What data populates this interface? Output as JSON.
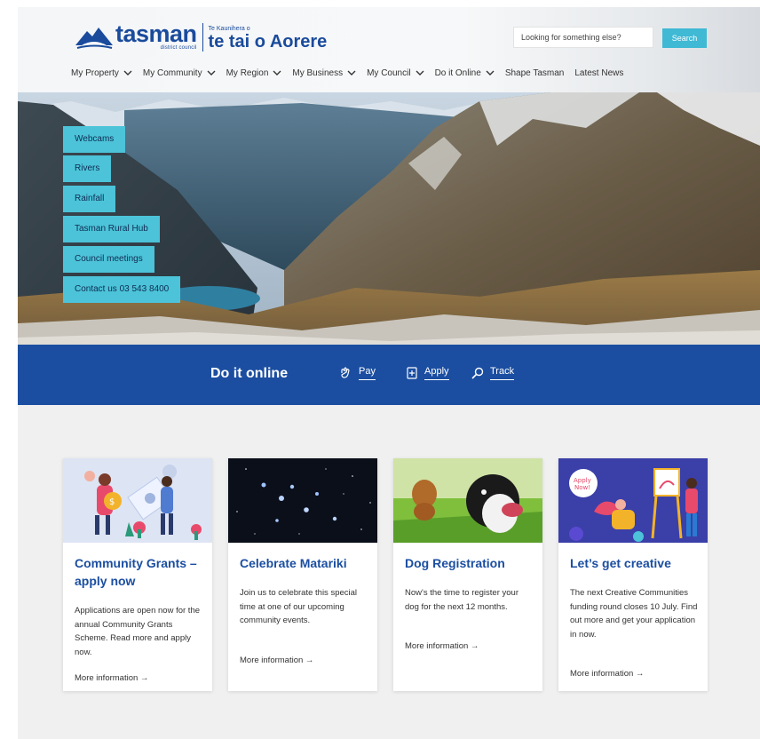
{
  "brand": {
    "name": "tasman",
    "sub": "district council",
    "maori_small": "Te Kaunihera o",
    "maori_big": "te tai o Aorere"
  },
  "search": {
    "placeholder": "Looking for something else?",
    "button_label": "Search"
  },
  "nav": {
    "items": [
      {
        "label": "My Property",
        "dropdown": true
      },
      {
        "label": "My Community",
        "dropdown": true
      },
      {
        "label": "My Region",
        "dropdown": true
      },
      {
        "label": "My Business",
        "dropdown": true
      },
      {
        "label": "My Council",
        "dropdown": true
      },
      {
        "label": "Do it Online",
        "dropdown": true
      },
      {
        "label": "Shape Tasman",
        "dropdown": false
      },
      {
        "label": "Latest News",
        "dropdown": false
      }
    ]
  },
  "quick_links": [
    "Webcams",
    "Rivers",
    "Rainfall",
    "Tasman Rural Hub",
    "Council meetings",
    "Contact us 03 543 8400"
  ],
  "do_it_online": {
    "title": "Do it online",
    "links": [
      {
        "label": "Pay",
        "icon": "pay-hand-icon"
      },
      {
        "label": "Apply",
        "icon": "apply-document-icon"
      },
      {
        "label": "Track",
        "icon": "track-magnifier-icon"
      }
    ]
  },
  "cards": [
    {
      "title": "Community Grants – apply now",
      "body": "Applications are open now for the annual Community Grants Scheme. Read more and apply now.",
      "more": "More information →",
      "image": "community-grants-illustration"
    },
    {
      "title": "Celebrate Matariki",
      "body": "Join us to celebrate this special time at one of our upcoming community events.",
      "more": "More information →",
      "image": "matariki-star-cluster"
    },
    {
      "title": "Dog Registration",
      "body": "Now's the time to register your dog for the next 12 months.",
      "more": "More information →",
      "image": "dogs-in-grass-photo"
    },
    {
      "title": "Let’s get creative",
      "body": "The next Creative Communities funding round closes 10 July. Find out more and get your application in now.",
      "more": "More information →",
      "image": "creative-communities-illustration"
    }
  ],
  "colors": {
    "brand_blue": "#1b4ea1",
    "accent_teal": "#4cc3d8",
    "search_button": "#3fb9d4"
  }
}
